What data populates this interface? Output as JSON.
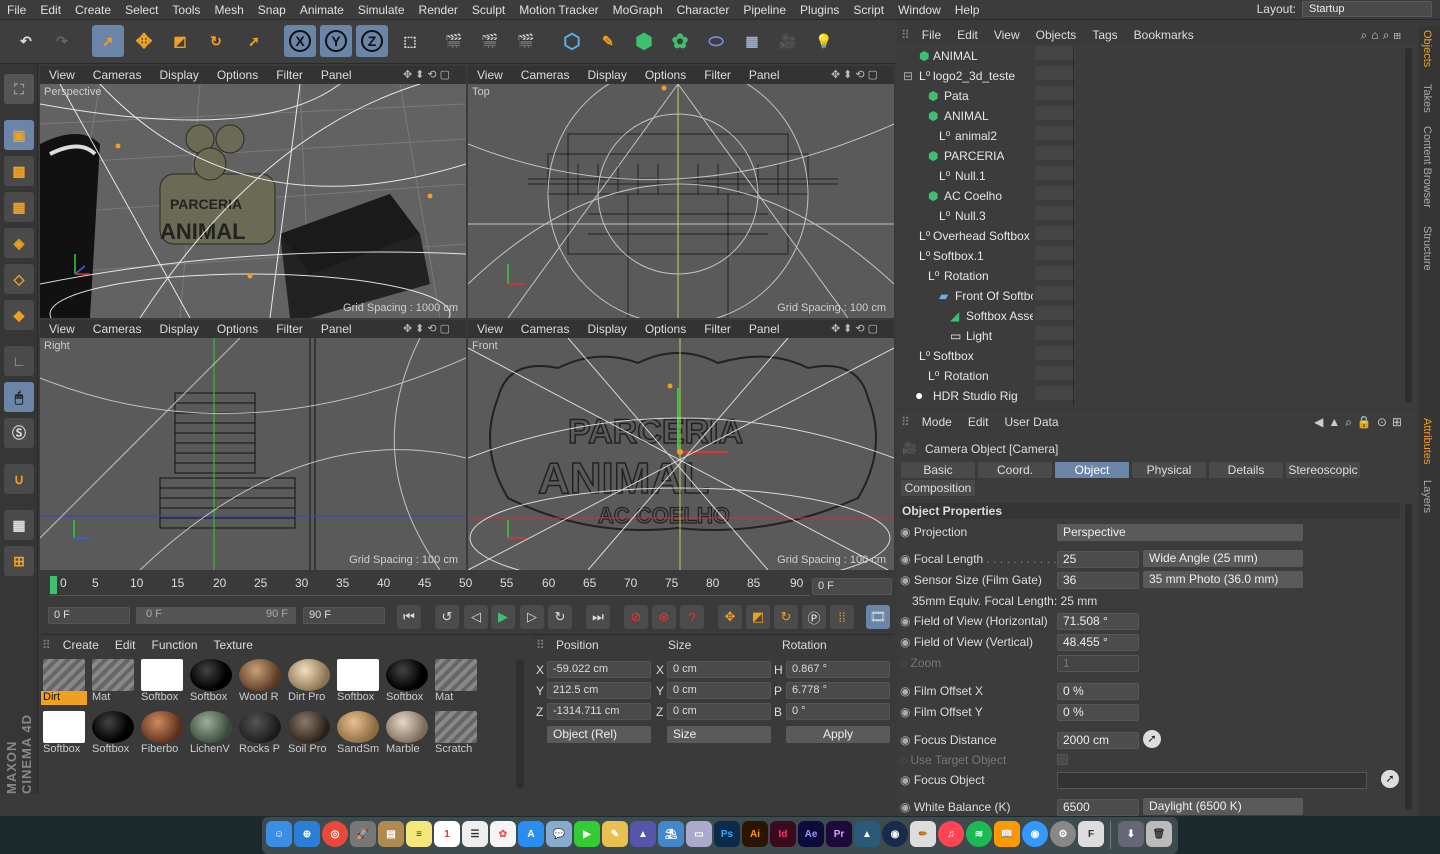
{
  "menubar": {
    "items": [
      "File",
      "Edit",
      "Create",
      "Select",
      "Tools",
      "Mesh",
      "Snap",
      "Animate",
      "Simulate",
      "Render",
      "Sculpt",
      "Motion Tracker",
      "MoGraph",
      "Character",
      "Pipeline",
      "Plugins",
      "Script",
      "Window",
      "Help"
    ],
    "layout_label": "Layout:",
    "layout_value": "Startup"
  },
  "viewport_menu": [
    "View",
    "Cameras",
    "Display",
    "Options",
    "Filter",
    "Panel"
  ],
  "viewports": [
    {
      "label": "Perspective",
      "grid": "Grid Spacing : 1000 cm"
    },
    {
      "label": "Top",
      "grid": "Grid Spacing : 100 cm"
    },
    {
      "label": "Right",
      "grid": "Grid Spacing : 100 cm"
    },
    {
      "label": "Front",
      "grid": "Grid Spacing : 100 cm"
    }
  ],
  "timeline": {
    "ticks": [
      "0",
      "5",
      "10",
      "15",
      "20",
      "25",
      "30",
      "35",
      "40",
      "45",
      "50",
      "55",
      "60",
      "65",
      "70",
      "75",
      "80",
      "85",
      "90"
    ],
    "current": "0 F"
  },
  "framectrl": {
    "start": "0 F",
    "min": "0 F",
    "max": "90 F",
    "end": "90 F"
  },
  "material_manager": {
    "menu": [
      "Create",
      "Edit",
      "Function",
      "Texture"
    ],
    "row1": [
      "Dirt",
      "Mat",
      "Softbox",
      "Softbox",
      "Wood R",
      "Dirt Pro",
      "Softbox",
      "Softbox",
      "Mat"
    ],
    "row2": [
      "Softbox",
      "Softbox",
      "Fiberbo",
      "LichenV",
      "Rocks P",
      "Soil Pro",
      "SandSm",
      "Marble",
      "Scratch"
    ]
  },
  "coord": {
    "headers": [
      "Position",
      "Size",
      "Rotation"
    ],
    "rows": [
      {
        "axis": "X",
        "pos": "-59.022 cm",
        "saxis": "X",
        "size": "0 cm",
        "raxis": "H",
        "rot": "0.867 °"
      },
      {
        "axis": "Y",
        "pos": "212.5 cm",
        "saxis": "Y",
        "size": "0 cm",
        "raxis": "P",
        "rot": "6.778 °"
      },
      {
        "axis": "Z",
        "pos": "-1314.711 cm",
        "saxis": "Z",
        "size": "0 cm",
        "raxis": "B",
        "rot": "0 °"
      }
    ],
    "mode": "Object (Rel)",
    "size_mode": "Size",
    "apply": "Apply"
  },
  "object_manager": {
    "menu": [
      "File",
      "Edit",
      "View",
      "Objects",
      "Tags",
      "Bookmarks"
    ],
    "rows": [
      {
        "name": "ANIMAL",
        "indent": 0
      },
      {
        "name": "logo2_3d_teste",
        "indent": 0
      },
      {
        "name": "Pata",
        "indent": 1
      },
      {
        "name": "ANIMAL",
        "indent": 1
      },
      {
        "name": "animal2",
        "indent": 2
      },
      {
        "name": "PARCERIA",
        "indent": 1
      },
      {
        "name": "Null.1",
        "indent": 2
      },
      {
        "name": "AC Coelho",
        "indent": 1
      },
      {
        "name": "Null.3",
        "indent": 2
      },
      {
        "name": "Overhead Softbox",
        "indent": 0
      },
      {
        "name": "Softbox.1",
        "indent": 0
      },
      {
        "name": "Rotation",
        "indent": 1
      },
      {
        "name": "Front Of Softbo",
        "indent": 2
      },
      {
        "name": "Softbox Asse",
        "indent": 3
      },
      {
        "name": "Light",
        "indent": 3
      },
      {
        "name": "Softbox",
        "indent": 0
      },
      {
        "name": "Rotation",
        "indent": 1
      },
      {
        "name": "HDR Studio Rig",
        "indent": 0
      }
    ]
  },
  "attributes": {
    "menu": [
      "Mode",
      "Edit",
      "User Data"
    ],
    "title": "Camera Object [Camera]",
    "tabs": [
      "Basic",
      "Coord.",
      "Object",
      "Physical",
      "Details",
      "Stereoscopic",
      "Composition"
    ],
    "section": "Object Properties",
    "projection_label": "Projection",
    "projection": "Perspective",
    "focal_label": "Focal Length",
    "focal": "25",
    "focal_preset": "Wide Angle (25 mm)",
    "sensor_label": "Sensor Size (Film Gate)",
    "sensor": "36",
    "sensor_preset": "35 mm Photo (36.0 mm)",
    "equiv": "35mm Equiv. Focal Length: 25 mm",
    "fovh_label": "Field of View (Horizontal)",
    "fovh": "71.508 °",
    "fovv_label": "Field of View (Vertical)",
    "fovv": "48.455 °",
    "zoom_label": "Zoom",
    "zoom": "1",
    "offx_label": "Film Offset X",
    "offx": "0 %",
    "offy_label": "Film Offset Y",
    "offy": "0 %",
    "focus_label": "Focus Distance",
    "focus": "2000 cm",
    "target_label": "Use Target Object",
    "focusobj_label": "Focus Object",
    "wb_label": "White Balance (K)",
    "wb": "6500",
    "wb_preset": "Daylight (6500 K)"
  },
  "side_tabs": [
    "Objects",
    "Takes",
    "Content Browser",
    "Structure",
    "Attributes",
    "Layers"
  ],
  "toolbar_axes": [
    "X",
    "Y",
    "Z"
  ],
  "dock": [
    "Ps",
    "Ai",
    "Id",
    "Ae",
    "Pr"
  ]
}
